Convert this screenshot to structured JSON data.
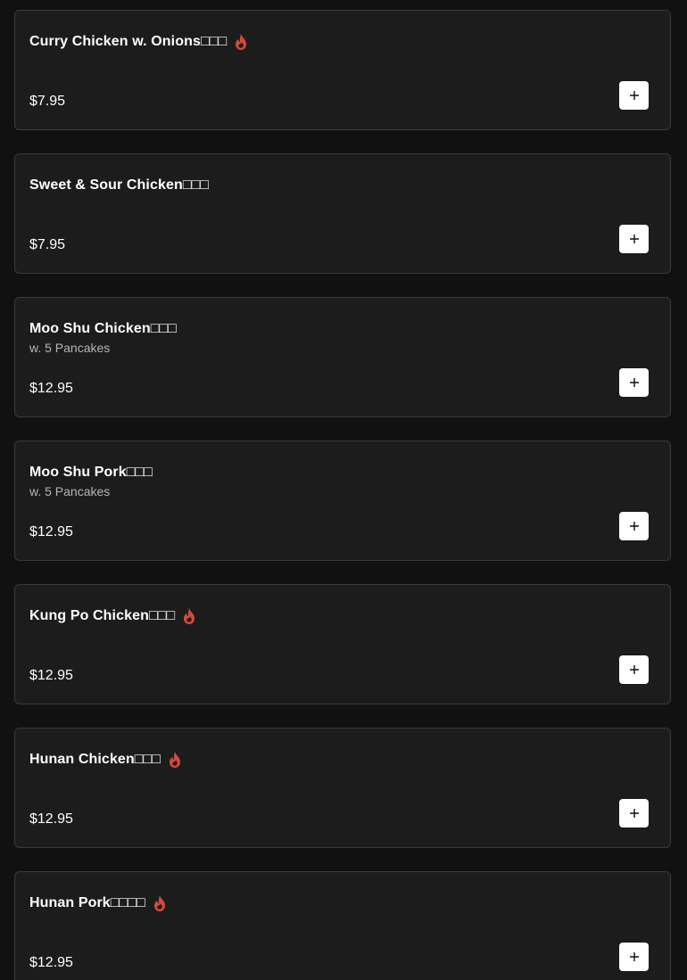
{
  "menu_items": [
    {
      "name": "Curry Chicken w. Onions□□□",
      "description": "",
      "price": "$7.95",
      "spicy": true,
      "add_icon": "plus-icon",
      "spicy_icon": "flame-icon"
    },
    {
      "name": "Sweet & Sour Chicken□□□",
      "description": "",
      "price": "$7.95",
      "spicy": false,
      "add_icon": "plus-icon"
    },
    {
      "name": "Moo Shu Chicken□□□",
      "description": "w. 5 Pancakes",
      "price": "$12.95",
      "spicy": false,
      "add_icon": "plus-icon"
    },
    {
      "name": "Moo Shu Pork□□□",
      "description": "w. 5 Pancakes",
      "price": "$12.95",
      "spicy": false,
      "add_icon": "plus-icon"
    },
    {
      "name": "Kung Po Chicken□□□",
      "description": "",
      "price": "$12.95",
      "spicy": true,
      "add_icon": "plus-icon",
      "spicy_icon": "flame-icon"
    },
    {
      "name": "Hunan Chicken□□□",
      "description": "",
      "price": "$12.95",
      "spicy": true,
      "add_icon": "plus-icon",
      "spicy_icon": "flame-icon"
    },
    {
      "name": "Hunan Pork□□□□",
      "description": "",
      "price": "$12.95",
      "spicy": true,
      "add_icon": "plus-icon",
      "spicy_icon": "flame-icon"
    }
  ],
  "colors": {
    "background": "#111111",
    "card_background": "#1c1c1c",
    "card_border": "#3a3a3a",
    "spicy": "#d64a3b",
    "button_background": "#ffffff"
  }
}
